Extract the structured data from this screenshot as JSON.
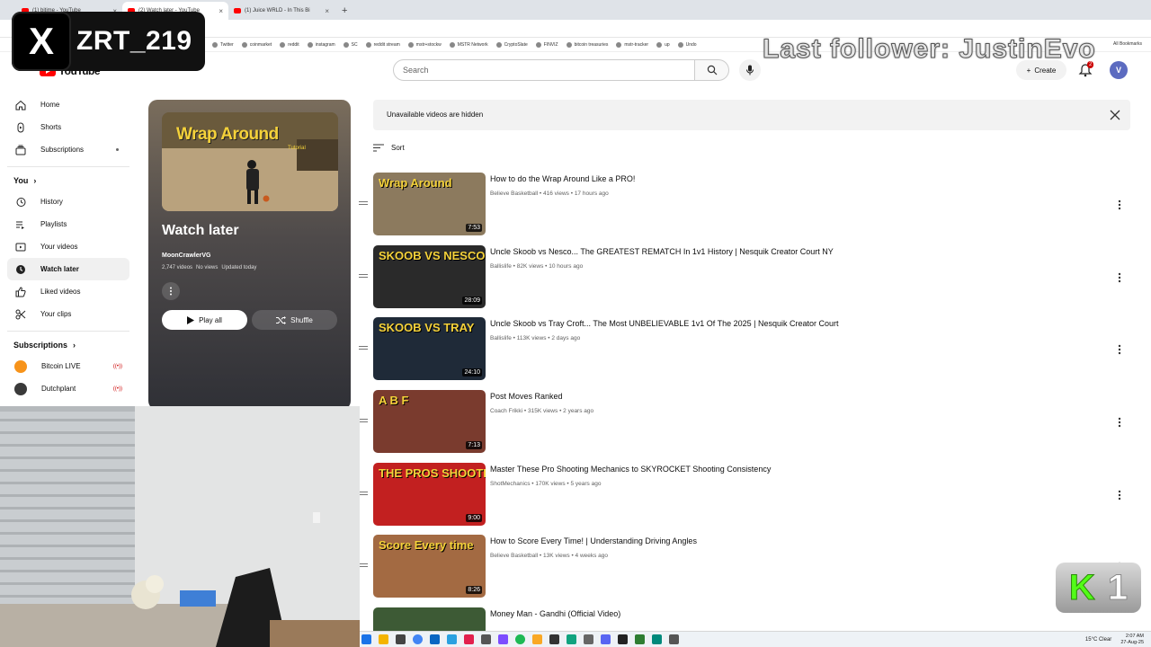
{
  "browser": {
    "tabs": [
      {
        "label": "(1) bitime - YouTube",
        "active": false
      },
      {
        "label": "(2) Watch later - YouTube",
        "active": true
      },
      {
        "label": "(1) Juice WRLD - In This Bi",
        "active": false
      }
    ],
    "bookmarks": [
      "Twitter",
      "coinmarket",
      "reddit",
      "instagram",
      "SC",
      "reddit stream",
      "mstr+stockw",
      "MSTR Network",
      "CryptoSlate",
      "FINVIZ",
      "bitcoin treasuries",
      "mstr-tracker",
      "up",
      "Undo"
    ],
    "all_bookmarks": "All Bookmarks"
  },
  "header": {
    "logo_text": "YouTube",
    "search_placeholder": "Search",
    "create_label": "Create",
    "notification_count": "2",
    "avatar_letter": "V"
  },
  "sidebar": {
    "top_items": [
      {
        "label": "Home",
        "icon": "home-icon"
      },
      {
        "label": "Shorts",
        "icon": "shorts-icon"
      },
      {
        "label": "Subscriptions",
        "icon": "subscriptions-icon"
      }
    ],
    "you_label": "You",
    "you_items": [
      {
        "label": "History",
        "icon": "history-icon"
      },
      {
        "label": "Playlists",
        "icon": "playlists-icon"
      },
      {
        "label": "Your videos",
        "icon": "your-videos-icon"
      },
      {
        "label": "Watch later",
        "icon": "clock-icon",
        "active": true
      },
      {
        "label": "Liked videos",
        "icon": "thumbs-up-icon"
      },
      {
        "label": "Your clips",
        "icon": "scissors-icon"
      }
    ],
    "subscriptions_label": "Subscriptions",
    "subscriptions": [
      {
        "label": "Bitcoin LIVE",
        "color": "#f7931a"
      },
      {
        "label": "Dutchplant",
        "color": "#3a3a3a"
      }
    ]
  },
  "playlist": {
    "thumb_title": "Wrap Around",
    "thumb_subtitle": "Tutorial",
    "title": "Watch later",
    "owner": "MoonCrawlerVG",
    "videos": "2,747 videos",
    "views": "No views",
    "updated": "Updated today",
    "play_all": "Play all",
    "shuffle": "Shuffle"
  },
  "main": {
    "notice": "Unavailable videos are hidden",
    "sort_label": "Sort",
    "videos": [
      {
        "title": "How to do the Wrap Around Like a PRO!",
        "channel": "Believe Basketball",
        "views": "416 views",
        "age": "17 hours ago",
        "duration": "7:53",
        "thumb_text": "Wrap Around",
        "thumb_bg": "#8c7a5e"
      },
      {
        "title": "Uncle Skoob vs Nesco... The GREATEST REMATCH In 1v1 History | Nesquik Creator Court NY",
        "channel": "Ballislife",
        "views": "82K views",
        "age": "10 hours ago",
        "duration": "28:09",
        "thumb_text": "SKOOB VS NESCO",
        "thumb_bg": "#2a2a2a"
      },
      {
        "title": "Uncle Skoob vs Tray Croft... The Most UNBELIEVABLE 1v1 Of The 2025 | Nesquik Creator Court",
        "channel": "Ballislife",
        "views": "113K views",
        "age": "2 days ago",
        "duration": "24:10",
        "thumb_text": "SKOOB VS TRAY",
        "thumb_bg": "#1f2a38"
      },
      {
        "title": "Post Moves Ranked",
        "channel": "Coach Frikki",
        "views": "315K views",
        "age": "2 years ago",
        "duration": "7:13",
        "thumb_text": "A  B  F",
        "thumb_bg": "#7a3b2e"
      },
      {
        "title": "Master These Pro Shooting Mechanics to SKYROCKET Shooting Consistency",
        "channel": "ShotMechanics",
        "views": "170K views",
        "age": "5 years ago",
        "duration": "9:00",
        "thumb_text": "THE PROS SHOOTING SECRETS!!!",
        "thumb_bg": "#c22020"
      },
      {
        "title": "How to Score Every Time! | Understanding Driving Angles",
        "channel": "Believe Basketball",
        "views": "13K views",
        "age": "4 weeks ago",
        "duration": "8:26",
        "thumb_text": "Score Every time",
        "thumb_bg": "#a36a42"
      },
      {
        "title": "Money Man - Gandhi (Official Video)",
        "channel": "",
        "views": "",
        "age": "",
        "duration": "",
        "thumb_text": "",
        "thumb_bg": "#3d5a35"
      }
    ]
  },
  "overlay": {
    "x_handle": "ZRT_219",
    "last_follower": "Last follower: JustinEvo",
    "kick_number": "1"
  },
  "taskbar": {
    "weather": "15°C Clear",
    "time": "2:07 AM",
    "date": "27-Aug-25"
  }
}
